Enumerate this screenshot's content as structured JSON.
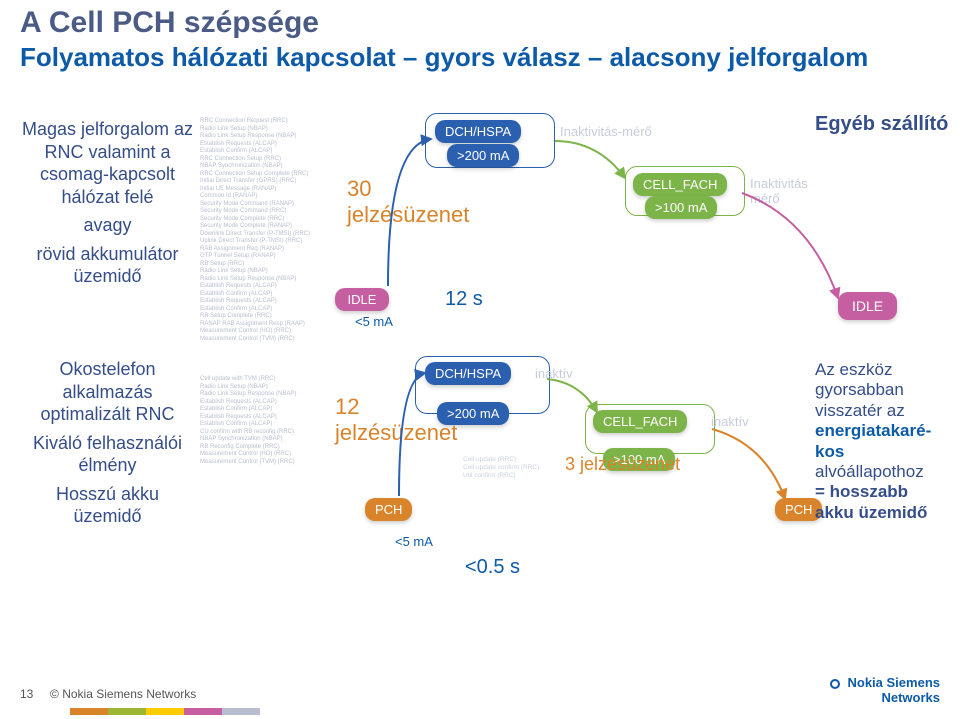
{
  "title": "A Cell PCH szépsége",
  "subtitle": "Folyamatos hálózati kapcsolat – gyors válasz – alacsony jelforgalom",
  "leftCol1": {
    "l1": "Magas jelforgalom az RNC valamint a csomag-kapcsolt hálózat felé",
    "l2": "avagy",
    "l3": "rövid akkumulátor üzemidő"
  },
  "leftCol2": {
    "l1": "Okostelefon alkalmazás optimalizált RNC",
    "l2": "Kiváló felhasználói élmény",
    "l3": "Hosszú akku üzemidő"
  },
  "list1": [
    "RRC Connection Request (RRC)",
    "Radio Link Setup (NBAP)",
    "Radio Link Setup Response (NBAP)",
    "Establish Requests (ALCAP)",
    "Establish Confirm (ALCAP)",
    "RRC Connection Setup (RRC)",
    "NBAP Synchronization (NBAP)",
    "RRC Connection Setup Complete (RRC)",
    "Initial Direct Transfer (GPRS) (RRC)",
    "Initial UE Message (RANAP)",
    "Common Id (RANAP)",
    "Security Mode Command (RANAP)",
    "Security Mode Command (RRC)",
    "Security Mode Complete (RRC)",
    "Security Mode Complete (RANAP)",
    "Downlink Direct Transfer (P-TMSI) (RRC)",
    "Uplink Direct Transfer (P-TMSI) (RRC)",
    "RAB Assignment Req (RANAP)",
    "GTP Tunnel Setup (RANAP)",
    "RB Setup (RRC)",
    "Radio Link Setup (NBAP)",
    "Radio Link Setup Response (NBAP)",
    "Establish Requests (ALCAP)",
    "Establish Confirm (ALCAP)",
    "Establish Requests (ALCAP)",
    "Establish Confirm (ALCAP)",
    "RB Setup Complete (RRC)",
    "RANAP RAB Assignment Resp (RAAP)",
    "Measurement Control (HO) (RRC)",
    "Measurement Control (TVM) (RRC)"
  ],
  "list2": [
    "Cell update with TVM (RRC)",
    "Radio Link Setup (NBAP)",
    "Radio Link Setup Response (NBAP)",
    "Establish Requests (ALCAP)",
    "Establish Confirm (ALCAP)",
    "Establish Requests (ALCAP)",
    "Establish Confirm (ALCAP)",
    "CU confirm with RB reconfig (RRC)",
    "NBAP Synchronization (NBAP)",
    "RB Reconfig Complete (RRC)",
    "Measurement Control (HO) (RRC)",
    "Measurement Control (TVM) (RRC)"
  ],
  "d1": {
    "n": "30",
    "nlabel": "jelzésüzenet",
    "dch": "DCH/HSPA",
    "dch_ma": ">200 mA",
    "inakt_mero": "Inaktivitás-mérő",
    "cell_fach": "CELL_FACH",
    "cell_fach_ma": ">100 mA",
    "inakt_mero2": "Inaktivitás mérő",
    "idle": "IDLE",
    "idle_ma": "<5 mA",
    "time": "12 s"
  },
  "d2": {
    "n": "12",
    "nlabel": "jelzésüzenet",
    "dch": "DCH/HSPA",
    "dch_ma": ">200 mA",
    "inaktiv": "inaktív",
    "cell_fach": "CELL_FACH",
    "cell_fach_ma": ">100 mA",
    "inaktiv2": "inaktív",
    "msgs": "Cell update (RRC)\nCell update confirm (RRC)\nUtil confirm (RRC)",
    "three": "3 jelzésüzenet",
    "pch1": "PCH",
    "pch2": "PCH",
    "idle_ma": "<5 mA",
    "time": "<0.5 s"
  },
  "right1": "Egyéb szállító",
  "right_idle": "IDLE",
  "right2": {
    "a": "Az eszköz gyorsabban visszatér az ",
    "b1": "energiatakaré-",
    "b2": "kos",
    "c": " alvóállapothoz",
    "d": "= hosszabb akku üzemidő"
  },
  "footer": {
    "page": "13",
    "copy": "© Nokia Siemens Networks"
  },
  "logo1": "Nokia Siemens",
  "logo2": "Networks",
  "bars": [
    "#d9832a",
    "#9fb534",
    "#ffcc00",
    "#c65fa1",
    "#b8bed0"
  ]
}
